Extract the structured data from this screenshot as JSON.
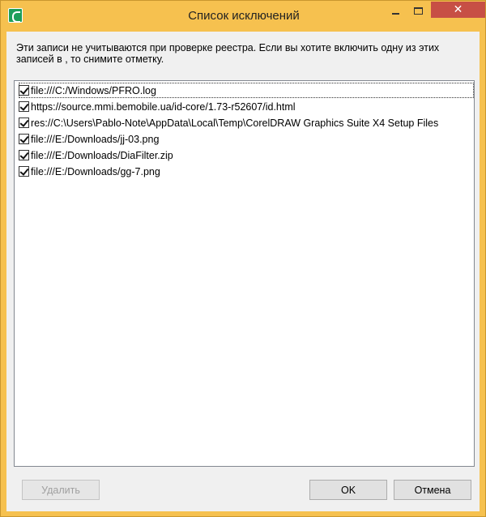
{
  "window": {
    "title": "Список исключений",
    "close_glyph": "✕"
  },
  "description": "Эти записи не учитываются при проверке реестра. Если вы хотите включить одну из этих записей в , то снимите отметку.",
  "exclusions": [
    {
      "label": "file:///C:/Windows/PFRO.log",
      "checked": true
    },
    {
      "label": "https://source.mmi.bemobile.ua/id-core/1.73-r52607/id.html",
      "checked": true
    },
    {
      "label": "res://C:\\Users\\Pablo-Note\\AppData\\Local\\Temp\\CorelDRAW Graphics Suite X4 Setup Files",
      "checked": true
    },
    {
      "label": "file:///E:/Downloads/jj-03.png",
      "checked": true
    },
    {
      "label": "file:///E:/Downloads/DiaFilter.zip",
      "checked": true
    },
    {
      "label": "file:///E:/Downloads/gg-7.png",
      "checked": true
    }
  ],
  "buttons": {
    "delete": "Удалить",
    "ok": "OK",
    "cancel": "Отмена"
  }
}
